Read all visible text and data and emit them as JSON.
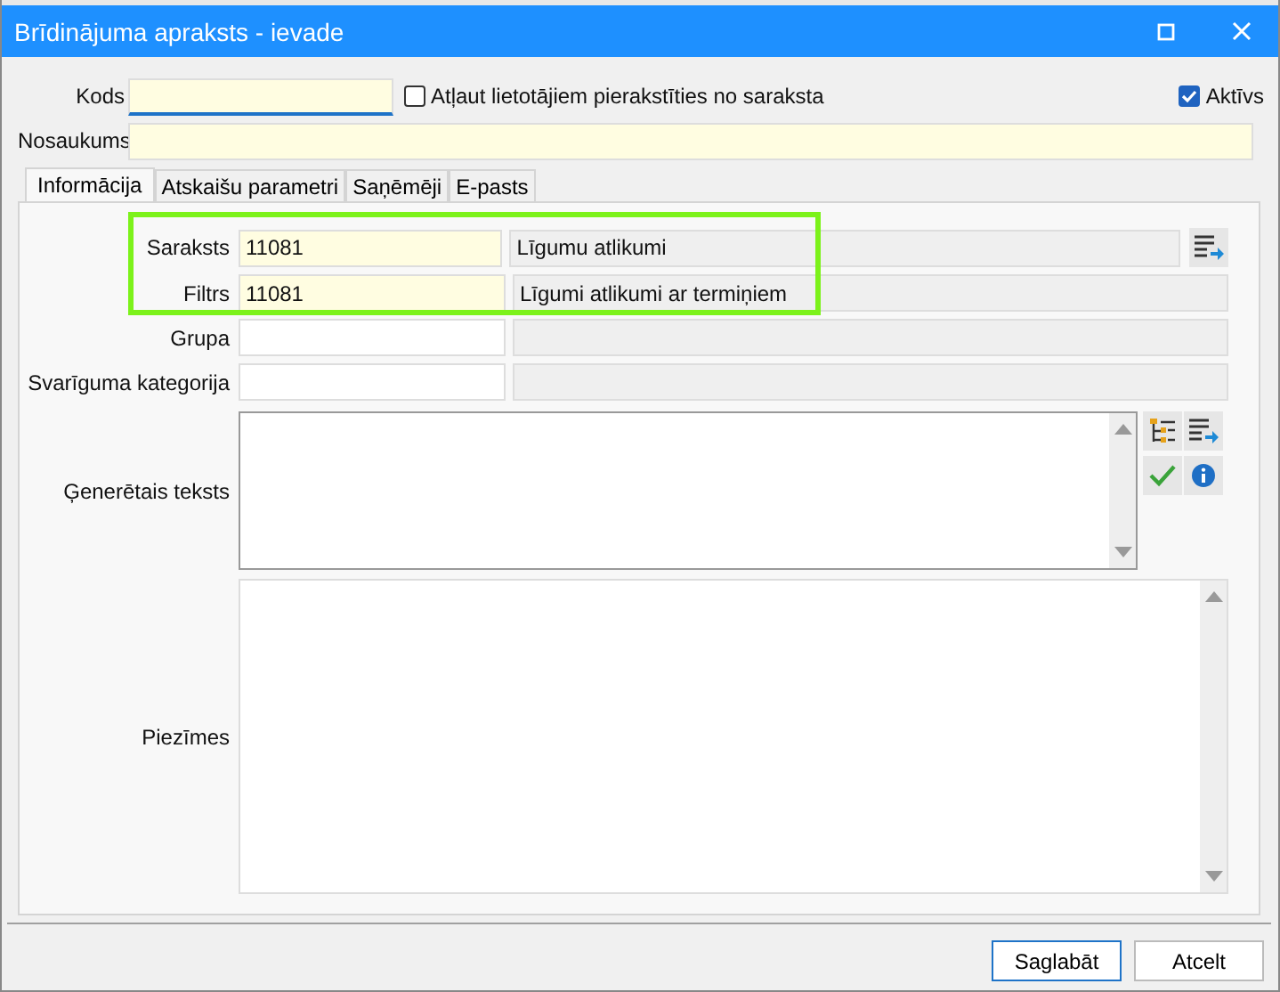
{
  "window": {
    "title": "Brīdinājuma apraksts - ievade"
  },
  "header": {
    "kods": {
      "label": "Kods",
      "required": true
    },
    "allow_checkbox": {
      "label": "Atļaut lietotājiem pierakstīties no saraksta",
      "checked": false
    },
    "active_checkbox": {
      "label": "Aktīvs",
      "checked": true
    },
    "nosaukums": {
      "label": "Nosaukums",
      "required": true
    }
  },
  "tabs": [
    {
      "label": "Informācija",
      "selected": true
    },
    {
      "label": "Atskaišu parametri",
      "selected": false
    },
    {
      "label": "Saņēmēji",
      "selected": false
    },
    {
      "label": "E-pasts",
      "selected": false
    }
  ],
  "form": [
    {
      "kind": "lookup",
      "label": "Saraksts",
      "code": "11081",
      "name": "Līgumu atlikumi",
      "required": true,
      "list_button": true,
      "highlighted": true
    },
    {
      "kind": "lookup",
      "label": "Filtrs",
      "code": "11081",
      "name": "Līgumi atlikumi ar termiņiem",
      "required": true,
      "list_button": false,
      "highlighted": true
    },
    {
      "kind": "lookup",
      "label": "Grupa",
      "required": false,
      "list_button": false,
      "highlighted": false
    },
    {
      "kind": "lookup",
      "label": "Svarīguma kategorija",
      "required": false,
      "list_button": false,
      "highlighted": false
    },
    {
      "kind": "memo",
      "label": "Ģenerētais teksts",
      "tools": [
        {
          "kind": "tree"
        },
        {
          "kind": "list"
        },
        {
          "kind": "check"
        },
        {
          "kind": "info"
        }
      ],
      "highlighted": false
    },
    {
      "kind": "notes",
      "label": "Piezīmes",
      "highlighted": false
    }
  ],
  "buttons": [
    {
      "label": "Saglabāt",
      "default": true
    },
    {
      "label": "Atcelt",
      "default": false
    }
  ]
}
